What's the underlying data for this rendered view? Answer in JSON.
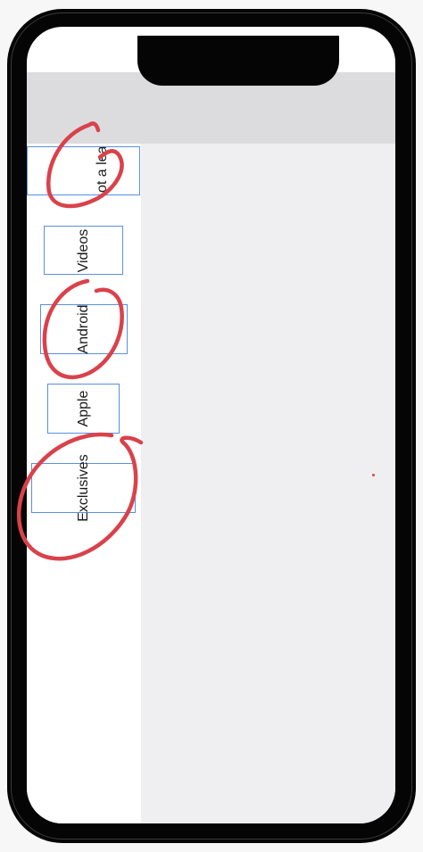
{
  "sidebar": {
    "items": [
      {
        "label": "Got a leak",
        "selected": true
      },
      {
        "label": "Videos",
        "selected": false
      },
      {
        "label": "Android",
        "selected": false
      },
      {
        "label": "Apple",
        "selected": false
      },
      {
        "label": "Exclusives",
        "selected": false
      }
    ]
  },
  "colors": {
    "frame": "#050505",
    "nav_bar": "#dcdcde",
    "content_bg": "#efeff1",
    "tab_border": "#5b8fe0",
    "annotation": "#d9424b"
  },
  "annotations": {
    "circled_items": [
      "Got a leak",
      "Android",
      "Exclusives"
    ]
  }
}
